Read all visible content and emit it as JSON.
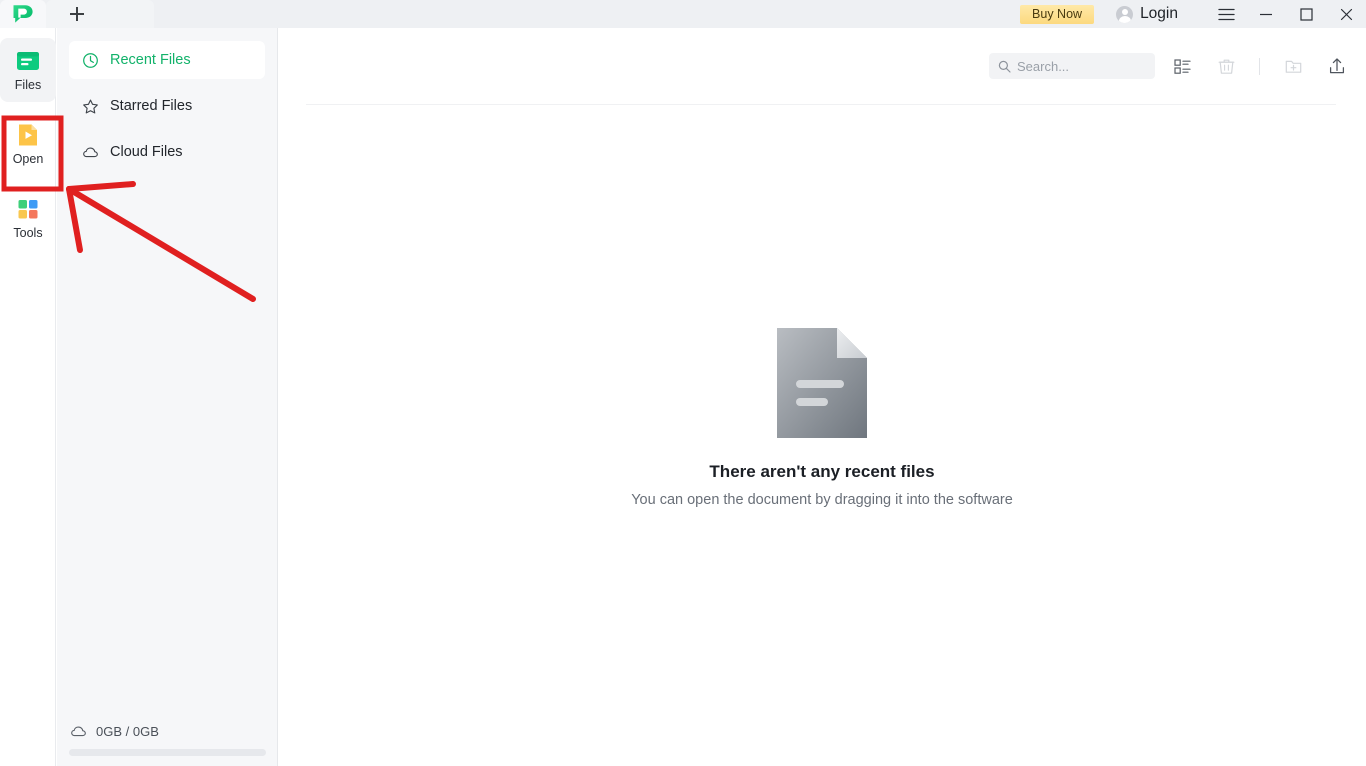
{
  "window": {
    "app_logo_icon": "pdf-speech-bubble-logo",
    "new_tab_label": "+",
    "buy_now_label": "Buy Now",
    "login_label": "Login",
    "menu_icon": "hamburger-menu-icon",
    "minimize_icon": "minimize-icon",
    "maximize_icon": "maximize-icon",
    "close_icon": "close-icon"
  },
  "rail": {
    "items": [
      {
        "label": "Files",
        "icon": "files-icon",
        "active": true
      },
      {
        "label": "Open",
        "icon": "open-document-icon",
        "active": false
      },
      {
        "label": "Tools",
        "icon": "tools-grid-icon",
        "active": false
      }
    ]
  },
  "nav": {
    "items": [
      {
        "label": "Recent Files",
        "icon": "clock-icon",
        "selected": true
      },
      {
        "label": "Starred Files",
        "icon": "star-icon",
        "selected": false
      },
      {
        "label": "Cloud Files",
        "icon": "cloud-icon",
        "selected": false
      }
    ],
    "storage": {
      "icon": "cloud-icon",
      "text": "0GB / 0GB",
      "used_percent": 0
    }
  },
  "toolbar": {
    "search": {
      "icon": "search-icon",
      "value": "",
      "placeholder": "Search..."
    },
    "buttons": [
      {
        "name": "list-view-icon",
        "label": "List view",
        "disabled": false
      },
      {
        "name": "trash-icon",
        "label": "Delete",
        "disabled": true
      },
      {
        "name": "new-folder-icon",
        "label": "New folder",
        "disabled": true
      },
      {
        "name": "upload-icon",
        "label": "Upload",
        "disabled": false
      }
    ]
  },
  "empty_state": {
    "illustration": "empty-document-illustration",
    "title": "There aren't any recent files",
    "subtitle": "You can open the document by dragging it into the software"
  },
  "annotations": {
    "highlight_color": "#e02020",
    "highlight_target": "Open",
    "arrow": "red-arrow-pointing-to-open-button"
  },
  "colors": {
    "accent_green": "#12b26a",
    "buy_now_bg": "#fcd97f",
    "annotation_red": "#e02020",
    "rail_active_bg": "#f2f3f5",
    "nav_bg": "#f6f7f9"
  }
}
